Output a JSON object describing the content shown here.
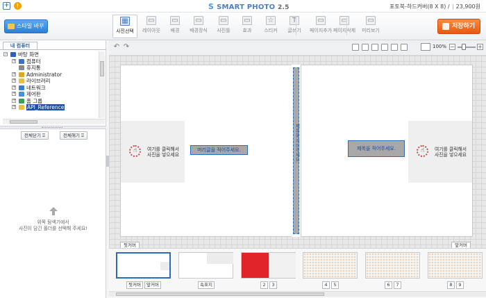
{
  "app": {
    "title": "SMART PHOTO",
    "version": "2.5",
    "logo_glyph": "S",
    "product_info": "포토북-하드커버(8 X 8) /",
    "price": "23,900원"
  },
  "toolbar": {
    "style_button": "스타일 바꾸기",
    "save_button": "저장하기",
    "tools": [
      {
        "label": "사진선택",
        "icon": "photo-select-icon",
        "glyph": "▦",
        "active": true
      },
      {
        "label": "레이아웃",
        "icon": "layout-icon",
        "glyph": "▭",
        "active": false
      },
      {
        "label": "배경",
        "icon": "background-icon",
        "glyph": "▭",
        "active": false
      },
      {
        "label": "배경장식",
        "icon": "background-decoration-icon",
        "glyph": "▭",
        "active": false
      },
      {
        "label": "사진틀",
        "icon": "photo-frame-icon",
        "glyph": "▭",
        "active": false
      },
      {
        "label": "효과",
        "icon": "effect-icon",
        "glyph": "▭",
        "active": false
      },
      {
        "label": "스티커",
        "icon": "sticker-icon",
        "glyph": "☆",
        "active": false
      },
      {
        "label": "글쓰기",
        "icon": "text-icon",
        "glyph": "T",
        "active": false
      },
      {
        "label": "페이지추가",
        "icon": "page-add-icon",
        "glyph": "▭",
        "active": false
      },
      {
        "label": "페이지삭제",
        "icon": "page-delete-icon",
        "glyph": "▭",
        "active": false
      },
      {
        "label": "미리보기",
        "icon": "preview-icon",
        "glyph": "▭",
        "active": false
      }
    ]
  },
  "left_panel": {
    "tab": "내 컴퓨터",
    "tree": [
      {
        "label": "바탕 화면",
        "indent": 0,
        "expander": "−",
        "icon_color": "#2c5fb5"
      },
      {
        "label": "컴퓨터",
        "indent": 1,
        "expander": "+",
        "icon_color": "#3b6fc4"
      },
      {
        "label": "휴지통",
        "indent": 1,
        "expander": "",
        "icon_color": "#8a8a8a"
      },
      {
        "label": "Administrator",
        "indent": 1,
        "expander": "+",
        "icon_color": "#e0a820"
      },
      {
        "label": "라이브러리",
        "indent": 1,
        "expander": "+",
        "icon_color": "#e8c040"
      },
      {
        "label": "네트워크",
        "indent": 1,
        "expander": "+",
        "icon_color": "#3b7fd0"
      },
      {
        "label": "제어판",
        "indent": 1,
        "expander": "+",
        "icon_color": "#4a90d8"
      },
      {
        "label": "홈 그룹",
        "indent": 1,
        "expander": "+",
        "icon_color": "#3aa060"
      },
      {
        "label": "API_Reference",
        "indent": 1,
        "expander": "+",
        "icon_color": "#e8c040",
        "selected": true
      }
    ],
    "select_all": "전체닫기",
    "deselect_all": "전체해기",
    "drop_hint_line1": "위쪽 탐색기에서",
    "drop_hint_line2": "사진이 담긴 폴더를 선택해 주세요!"
  },
  "editor": {
    "zoom_value": "100%",
    "zoom_level": 0.3,
    "left_page": {
      "photo_hint_line1": "여기를 클릭해서",
      "photo_hint_line2": "사진을 넣으세요",
      "text_box": "머리글을 적어주세요."
    },
    "right_page": {
      "photo_hint_line1": "여기를 클릭해서",
      "photo_hint_line2": "사진을 넣으세요",
      "text_box": "제목을 적어주세요."
    },
    "spine_text": "제목을 적어주세요.",
    "back_cover_label": "뒷커버",
    "front_cover_label": "앞커버"
  },
  "thumbnails": [
    {
      "labels": [
        "뒷커버",
        "앞커버"
      ],
      "selected": true
    },
    {
      "labels": [
        "속표지"
      ],
      "selected": false
    },
    {
      "labels": [
        "2",
        "3"
      ],
      "selected": false,
      "accent": "#e0242a"
    },
    {
      "labels": [
        "4",
        "5"
      ],
      "selected": false
    },
    {
      "labels": [
        "6",
        "7"
      ],
      "selected": false
    },
    {
      "labels": [
        "8",
        "9"
      ],
      "selected": false
    }
  ],
  "colors": {
    "accent_blue": "#2a6cb6",
    "save_orange": "#e85a10",
    "spine_gray": "#a9a9a9"
  }
}
